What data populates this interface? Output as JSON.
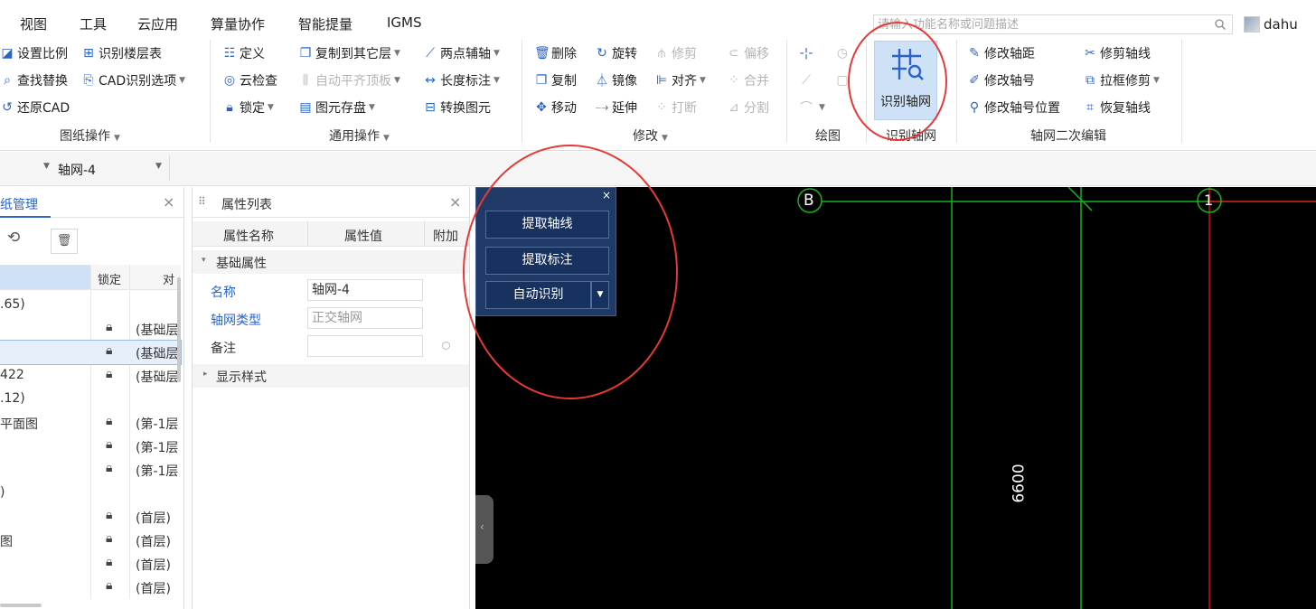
{
  "menu": [
    "视图",
    "工具",
    "云应用",
    "算量协作",
    "智能提量",
    "IGMS"
  ],
  "search": {
    "placeholder": "请输入功能名称或问题描述"
  },
  "user": {
    "name": "dahu"
  },
  "ribbon": {
    "drawing_ops": {
      "label": "图纸操作",
      "items": [
        "设置比例",
        "识别楼层表",
        "查找替换",
        "CAD识别选项",
        "还原CAD"
      ]
    },
    "general_ops": {
      "label": "通用操作",
      "items": [
        "定义",
        "复制到其它层",
        "两点辅轴",
        "云检查",
        "自动平齐顶板",
        "长度标注",
        "锁定",
        "图元存盘",
        "转换图元"
      ]
    },
    "modify": {
      "label": "修改",
      "items": [
        "删除",
        "旋转",
        "修剪",
        "偏移",
        "复制",
        "镜像",
        "对齐",
        "合并",
        "移动",
        "延伸",
        "打断",
        "分割"
      ]
    },
    "draw": {
      "label": "绘图"
    },
    "recognize": {
      "label": "识别轴网",
      "button": "识别轴网"
    },
    "secondary": {
      "label": "轴网二次编辑",
      "items": [
        "修改轴距",
        "修剪轴线",
        "修改轴号",
        "拉框修剪",
        "修改轴号位置",
        "恢复轴线"
      ]
    }
  },
  "selector": {
    "value": "轴网-4"
  },
  "draw_panel": {
    "title": "纸管理",
    "col_lock": "锁定",
    "col_corr": "对",
    "rows": [
      {
        "name": ".65)",
        "lock": false,
        "corr": ""
      },
      {
        "name": "",
        "lock": true,
        "corr": "(基础层"
      },
      {
        "name": "",
        "lock": true,
        "corr": "(基础层"
      },
      {
        "name": "422",
        "lock": true,
        "corr": "(基础层"
      },
      {
        "name": ".12)",
        "lock": false,
        "corr": ""
      },
      {
        "name": "平面图",
        "lock": true,
        "corr": "(第-1层"
      },
      {
        "name": "",
        "lock": true,
        "corr": "(第-1层"
      },
      {
        "name": "",
        "lock": true,
        "corr": "(第-1层"
      },
      {
        "name": ")",
        "lock": false,
        "corr": ""
      },
      {
        "name": "",
        "lock": true,
        "corr": "(首层)"
      },
      {
        "name": "图",
        "lock": true,
        "corr": "(首层)"
      },
      {
        "name": "",
        "lock": true,
        "corr": "(首层)"
      },
      {
        "name": "",
        "lock": true,
        "corr": "(首层)"
      }
    ]
  },
  "prop_panel": {
    "title": "属性列表",
    "headers": [
      "属性名称",
      "属性值",
      "附加"
    ],
    "section_basic": "基础属性",
    "section_style": "显示样式",
    "props": [
      {
        "name": "名称",
        "value": "轴网-4"
      },
      {
        "name": "轴网类型",
        "value": "正交轴网"
      },
      {
        "name": "备注",
        "value": ""
      }
    ]
  },
  "float_panel": {
    "buttons": [
      "提取轴线",
      "提取标注",
      "自动识别"
    ]
  },
  "canvas": {
    "axis_b": "B",
    "axis_1": "1",
    "dimension": "6600"
  },
  "colors": {
    "ribbon_icon": "#2b63c7",
    "annotation": "#e53935",
    "grid_green": "#18b318",
    "grid_red": "#d01010",
    "panel_blue": "#1f3a66"
  }
}
